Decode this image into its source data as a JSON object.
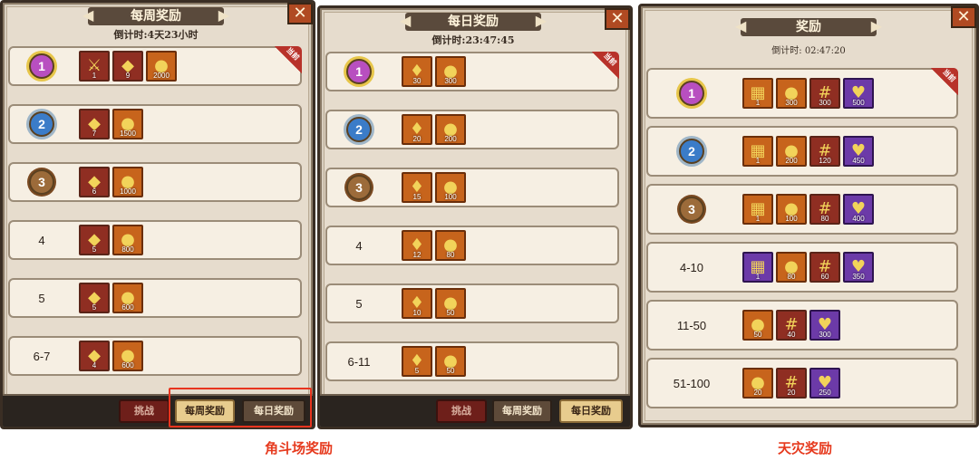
{
  "colors": {
    "accent": "#e63a1e",
    "panel": "#e6dccd",
    "row": "#f6efe3"
  },
  "weekly": {
    "title": "每周奖励",
    "countdown": "倒计时:4天23小时",
    "current_tag": "当前",
    "rows": [
      {
        "rank": "1",
        "medal": "gold",
        "items": [
          {
            "kind": "scroll",
            "q": "1"
          },
          {
            "kind": "ore",
            "q": "9"
          },
          {
            "kind": "coin",
            "q": "2000"
          }
        ]
      },
      {
        "rank": "2",
        "medal": "silver",
        "items": [
          {
            "kind": "ore",
            "q": "7"
          },
          {
            "kind": "coin",
            "q": "1500"
          }
        ]
      },
      {
        "rank": "3",
        "medal": "bronze",
        "items": [
          {
            "kind": "ore",
            "q": "6"
          },
          {
            "kind": "coin",
            "q": "1000"
          }
        ]
      },
      {
        "rank": "4",
        "items": [
          {
            "kind": "ore",
            "q": "5"
          },
          {
            "kind": "coin",
            "q": "800"
          }
        ]
      },
      {
        "rank": "5",
        "items": [
          {
            "kind": "ore",
            "q": "5"
          },
          {
            "kind": "coin",
            "q": "600"
          }
        ]
      },
      {
        "rank": "6-7",
        "items": [
          {
            "kind": "ore",
            "q": "4"
          },
          {
            "kind": "coin",
            "q": "600"
          }
        ]
      }
    ],
    "buttons": {
      "challenge": "挑战",
      "weekly": "每周奖励",
      "daily": "每日奖励"
    }
  },
  "daily": {
    "title": "每日奖励",
    "countdown": "倒计时:23:47:45",
    "current_tag": "当前",
    "rows": [
      {
        "rank": "1",
        "medal": "gold",
        "items": [
          {
            "kind": "potion",
            "q": "30"
          },
          {
            "kind": "coin",
            "q": "300"
          }
        ]
      },
      {
        "rank": "2",
        "medal": "silver",
        "items": [
          {
            "kind": "potion",
            "q": "20"
          },
          {
            "kind": "coin",
            "q": "200"
          }
        ]
      },
      {
        "rank": "3",
        "medal": "bronze",
        "items": [
          {
            "kind": "potion",
            "q": "15"
          },
          {
            "kind": "coin",
            "q": "100"
          }
        ]
      },
      {
        "rank": "4",
        "items": [
          {
            "kind": "potion",
            "q": "12"
          },
          {
            "kind": "coin",
            "q": "80"
          }
        ]
      },
      {
        "rank": "5",
        "items": [
          {
            "kind": "potion",
            "q": "10"
          },
          {
            "kind": "coin",
            "q": "50"
          }
        ]
      },
      {
        "rank": "6-11",
        "items": [
          {
            "kind": "potion",
            "q": "5"
          },
          {
            "kind": "coin",
            "q": "50"
          }
        ]
      }
    ],
    "buttons": {
      "challenge": "挑战",
      "weekly": "每周奖励",
      "daily": "每日奖励"
    }
  },
  "disaster": {
    "title": "奖励",
    "countdown": "倒计时: 02:47:20",
    "current_tag": "当前",
    "rows": [
      {
        "rank": "1",
        "medal": "gold",
        "items": [
          {
            "kind": "crate",
            "q": "1",
            "tier": "orange"
          },
          {
            "kind": "coin",
            "q": "300",
            "tier": "orange"
          },
          {
            "kind": "net",
            "q": "300",
            "tier": "red"
          },
          {
            "kind": "bag",
            "q": "500",
            "tier": "purple"
          }
        ]
      },
      {
        "rank": "2",
        "medal": "silver",
        "items": [
          {
            "kind": "crate",
            "q": "1",
            "tier": "orange"
          },
          {
            "kind": "coin",
            "q": "200",
            "tier": "orange"
          },
          {
            "kind": "net",
            "q": "120",
            "tier": "red"
          },
          {
            "kind": "bag",
            "q": "450",
            "tier": "purple"
          }
        ]
      },
      {
        "rank": "3",
        "medal": "bronze",
        "items": [
          {
            "kind": "crate",
            "q": "1",
            "tier": "orange"
          },
          {
            "kind": "coin",
            "q": "100",
            "tier": "orange"
          },
          {
            "kind": "net",
            "q": "80",
            "tier": "red"
          },
          {
            "kind": "bag",
            "q": "400",
            "tier": "purple"
          }
        ]
      },
      {
        "rank": "4-10",
        "items": [
          {
            "kind": "crate",
            "q": "1",
            "tier": "purple"
          },
          {
            "kind": "coin",
            "q": "80",
            "tier": "orange"
          },
          {
            "kind": "net",
            "q": "60",
            "tier": "red"
          },
          {
            "kind": "bag",
            "q": "350",
            "tier": "purple"
          }
        ]
      },
      {
        "rank": "11-50",
        "items": [
          {
            "kind": "coin",
            "q": "50",
            "tier": "orange"
          },
          {
            "kind": "net",
            "q": "40",
            "tier": "red"
          },
          {
            "kind": "bag",
            "q": "300",
            "tier": "purple"
          }
        ]
      },
      {
        "rank": "51-100",
        "items": [
          {
            "kind": "coin",
            "q": "20",
            "tier": "orange"
          },
          {
            "kind": "net",
            "q": "20",
            "tier": "red"
          },
          {
            "kind": "bag",
            "q": "250",
            "tier": "purple"
          }
        ]
      }
    ]
  },
  "captions": {
    "left": "角斗场奖励",
    "right": "天灾奖励"
  }
}
